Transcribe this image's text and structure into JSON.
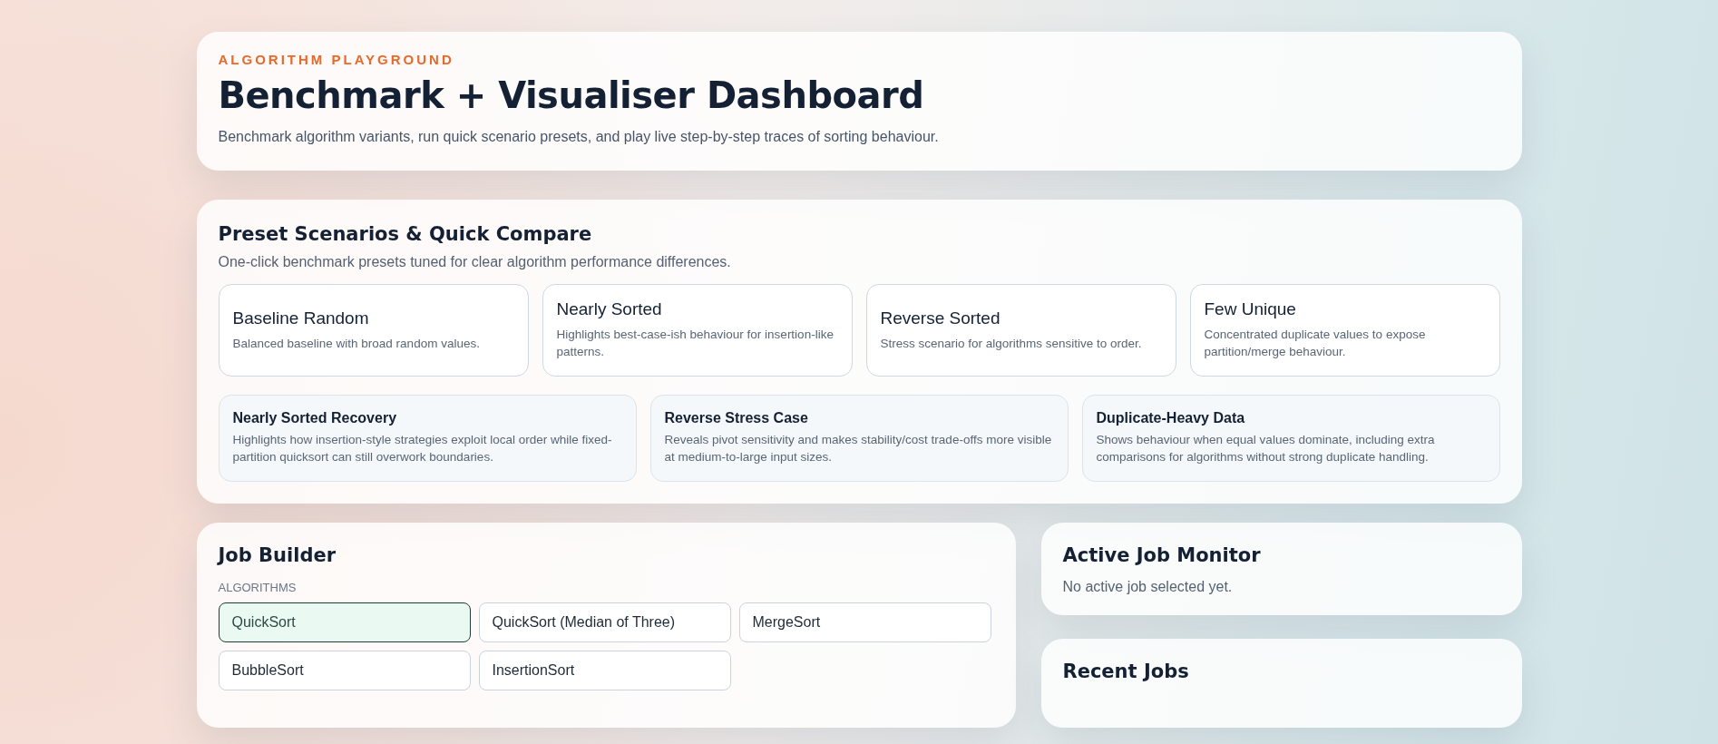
{
  "header": {
    "eyebrow": "ALGORITHM PLAYGROUND",
    "title": "Benchmark + Visualiser Dashboard",
    "description": "Benchmark algorithm variants, run quick scenario presets, and play live step-by-step traces of sorting behaviour."
  },
  "presets": {
    "title": "Preset Scenarios & Quick Compare",
    "description": "One-click benchmark presets tuned for clear algorithm performance differences.",
    "items": [
      {
        "kind": "scenario",
        "title": "Baseline Random",
        "description": "Balanced baseline with broad random values."
      },
      {
        "kind": "scenario",
        "title": "Nearly Sorted",
        "description": "Highlights best-case-ish behaviour for insertion-like patterns."
      },
      {
        "kind": "scenario",
        "title": "Reverse Sorted",
        "description": "Stress scenario for algorithms sensitive to order."
      },
      {
        "kind": "scenario",
        "title": "Few Unique",
        "description": "Concentrated duplicate values to expose partition/merge behaviour."
      },
      {
        "kind": "compare",
        "title": "Nearly Sorted Recovery",
        "description": "Highlights how insertion-style strategies exploit local order while fixed-partition quicksort can still overwork boundaries."
      },
      {
        "kind": "compare",
        "title": "Reverse Stress Case",
        "description": "Reveals pivot sensitivity and makes stability/cost trade-offs more visible at medium-to-large input sizes."
      },
      {
        "kind": "compare",
        "title": "Duplicate-Heavy Data",
        "description": "Shows behaviour when equal values dominate, including extra comparisons for algorithms without strong duplicate handling."
      }
    ]
  },
  "job_builder": {
    "title": "Job Builder",
    "algorithms_label": "ALGORITHMS",
    "algorithms": [
      {
        "label": "QuickSort",
        "selected": true
      },
      {
        "label": "QuickSort (Median of Three)",
        "selected": false
      },
      {
        "label": "MergeSort",
        "selected": false
      },
      {
        "label": "BubbleSort",
        "selected": false
      },
      {
        "label": "InsertionSort",
        "selected": false
      }
    ]
  },
  "active_job_monitor": {
    "title": "Active Job Monitor",
    "message": "No active job selected yet."
  },
  "recent_jobs": {
    "title": "Recent Jobs"
  }
}
